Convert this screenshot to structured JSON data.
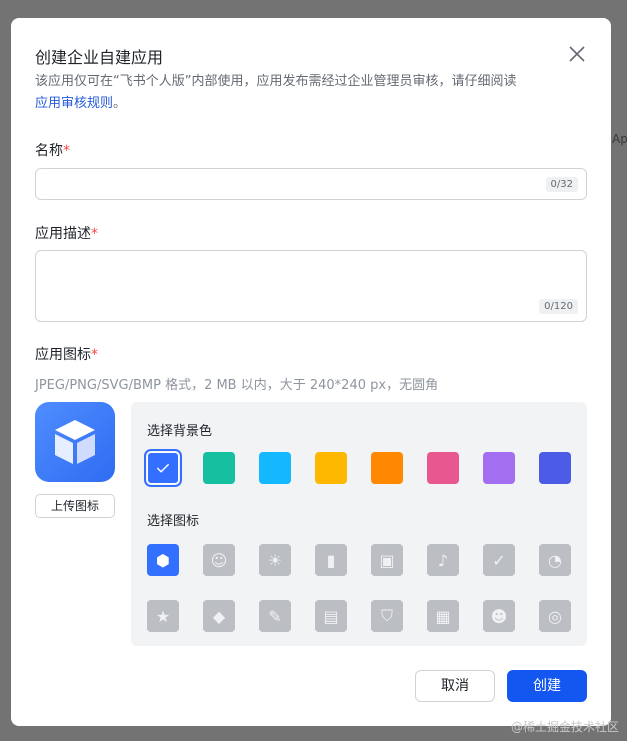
{
  "dialog": {
    "title": "创建企业自建应用",
    "description": "该应用仅可在“飞书个人版”内部使用，应用发布需经过企业管理员审核，请仔细阅读",
    "rules_link": "应用审核规则",
    "rules_suffix": "。",
    "name_label": "名称",
    "name_counter": "0/32",
    "name_value": "",
    "desc_label": "应用描述",
    "desc_counter": "0/120",
    "desc_value": "",
    "icon_label": "应用图标",
    "required_mark": "*",
    "icon_hint": "JPEG/PNG/SVG/BMP 格式，2 MB 以内，大于 240*240 px，无圆角",
    "upload_label": "上传图标",
    "bg_title": "选择背景色",
    "icon_title": "选择图标",
    "cancel_label": "取消",
    "create_label": "创建"
  },
  "bg_colors": [
    "#3370ff",
    "#14c0a0",
    "#14b8ff",
    "#ffb800",
    "#ff8800",
    "#e8578f",
    "#a36ef0",
    "#4c5ce6"
  ],
  "selected_bg_index": 0,
  "icons": [
    "cube-icon",
    "robot-icon",
    "lightbulb-icon",
    "door-icon",
    "briefcase-icon",
    "bell-icon",
    "bookmark-check-icon",
    "pie-chart-icon",
    "star-icon",
    "tag-icon",
    "wrench-icon",
    "document-icon",
    "shield-check-icon",
    "layout-icon",
    "users-icon",
    "code-icon"
  ],
  "selected_icon_index": 0,
  "watermark": "@稀土掘金技术社区"
}
